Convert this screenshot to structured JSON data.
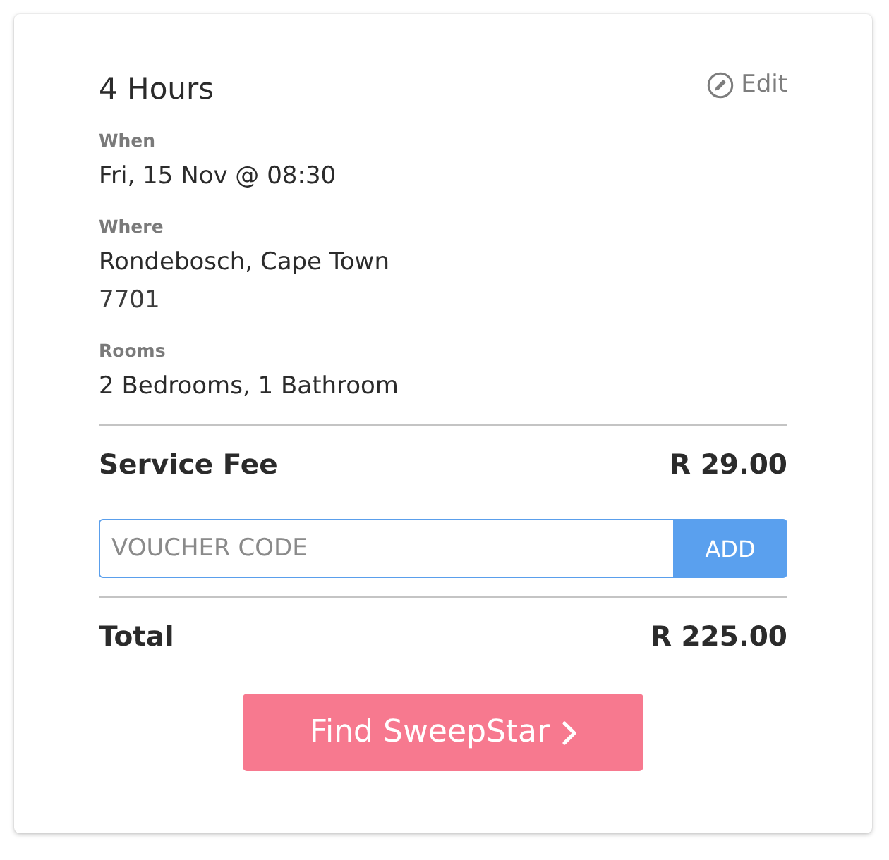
{
  "summary": {
    "title": "4 Hours",
    "edit_label": "Edit"
  },
  "details": [
    {
      "label": "When",
      "lines": [
        "Fri, 15 Nov @ 08:30"
      ]
    },
    {
      "label": "Where",
      "lines": [
        "Rondebosch, Cape Town",
        "7701"
      ]
    },
    {
      "label": "Rooms",
      "lines": [
        "2 Bedrooms, 1 Bathroom"
      ]
    }
  ],
  "service_fee": {
    "label": "Service Fee",
    "amount": "R 29.00"
  },
  "voucher": {
    "placeholder": "VOUCHER CODE",
    "button": "ADD"
  },
  "total": {
    "label": "Total",
    "amount": "R 225.00"
  },
  "primary_button": {
    "label": "Find SweepStar"
  }
}
